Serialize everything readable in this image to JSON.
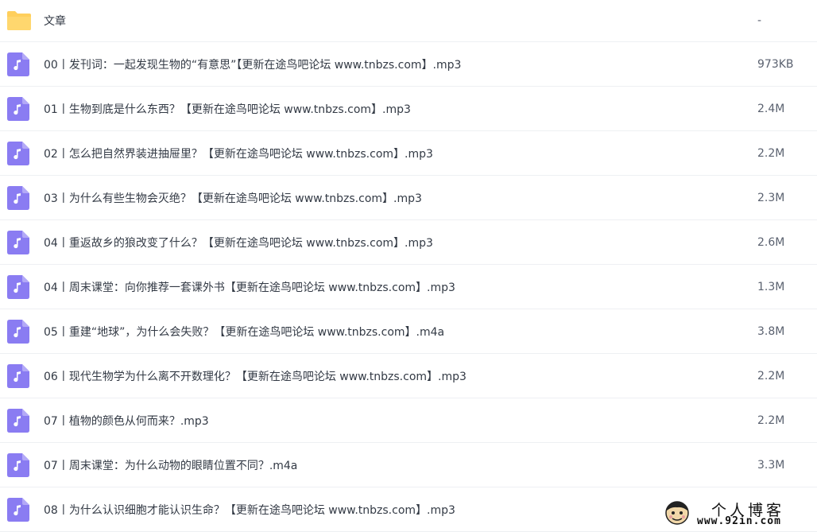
{
  "colors": {
    "audio_icon": "#8a7cf2",
    "folder_icon": "#ffcf5c",
    "text": "#333a45"
  },
  "files": [
    {
      "icon": "folder-icon",
      "name": "文章",
      "size": "-"
    },
    {
      "icon": "music-file-icon",
      "name": "00丨发刊词：一起发现生物的“有意思”【更新在途鸟吧论坛 www.tnbzs.com】.mp3",
      "size": "973KB"
    },
    {
      "icon": "music-file-icon",
      "name": "01丨生物到底是什么东西？【更新在途鸟吧论坛 www.tnbzs.com】.mp3",
      "size": "2.4M"
    },
    {
      "icon": "music-file-icon",
      "name": "02丨怎么把自然界装进抽屉里？【更新在途鸟吧论坛 www.tnbzs.com】.mp3",
      "size": "2.2M"
    },
    {
      "icon": "music-file-icon",
      "name": "03丨为什么有些生物会灭绝？【更新在途鸟吧论坛 www.tnbzs.com】.mp3",
      "size": "2.3M"
    },
    {
      "icon": "music-file-icon",
      "name": "04丨重返故乡的狼改变了什么？【更新在途鸟吧论坛 www.tnbzs.com】.mp3",
      "size": "2.6M"
    },
    {
      "icon": "music-file-icon",
      "name": "04丨周末课堂：向你推荐一套课外书【更新在途鸟吧论坛 www.tnbzs.com】.mp3",
      "size": "1.3M"
    },
    {
      "icon": "music-file-icon",
      "name": "05丨重建“地球”，为什么会失败？【更新在途鸟吧论坛 www.tnbzs.com】.m4a",
      "size": "3.8M"
    },
    {
      "icon": "music-file-icon",
      "name": "06丨现代生物学为什么离不开数理化？【更新在途鸟吧论坛 www.tnbzs.com】.mp3",
      "size": "2.2M"
    },
    {
      "icon": "music-file-icon",
      "name": "07丨植物的颜色从何而来？.mp3",
      "size": "2.2M"
    },
    {
      "icon": "music-file-icon",
      "name": "07丨周末课堂：为什么动物的眼睛位置不同？.m4a",
      "size": "3.3M"
    },
    {
      "icon": "music-file-icon",
      "name": "08丨为什么认识细胞才能认识生命？【更新在途鸟吧论坛 www.tnbzs.com】.mp3",
      "size": ""
    }
  ],
  "watermark": {
    "title": "个人博客",
    "url": "www.92in.com"
  }
}
